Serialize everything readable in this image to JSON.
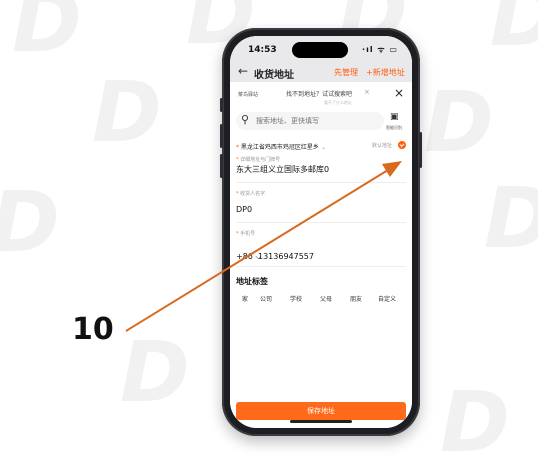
{
  "annotation": {
    "step_number": "10"
  },
  "status_bar": {
    "time": "14:53",
    "icons": "·ıl ᯤ ▭"
  },
  "page_header": {
    "title": "收货地址",
    "left_action": "先管理",
    "right_action": "+新增地址"
  },
  "sheet": {
    "brand": "菜鸟驿站",
    "tip": "找不到地址？试试搜索吧",
    "tip_close": "×",
    "tip_sub": "看不了什么地址",
    "close": "×"
  },
  "search": {
    "placeholder": "搜索地址、更快填写",
    "scan_label": "智能识别"
  },
  "address": {
    "region": "黑龙江省鸡西市鸡冠区红星乡",
    "default_label": "默认地址",
    "detail_label": "详细地址与门牌号",
    "detail_value": "东大三组义立国际多邮库0"
  },
  "recipient": {
    "label": "收货人名字",
    "value": "DP0"
  },
  "phone": {
    "label": "手机号",
    "country_code": "+86 ⌵",
    "value": "13136947557"
  },
  "tags": {
    "title": "地址标签",
    "items": [
      "家",
      "公司",
      "学校",
      "父母",
      "朋友",
      "自定义"
    ]
  },
  "save_button": {
    "label": "保存地址"
  },
  "colors": {
    "accent": "#ff6a1a",
    "arrow": "#d9691e"
  }
}
